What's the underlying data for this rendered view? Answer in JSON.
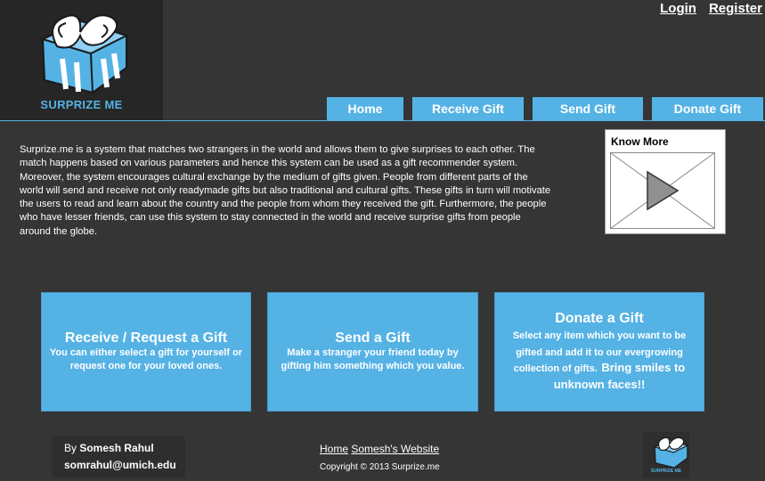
{
  "brand": {
    "name": "SURPRIZE ME",
    "logo_icon": "gift-box-icon"
  },
  "auth": {
    "login": "Login",
    "register": "Register"
  },
  "nav": {
    "home": "Home",
    "receive": "Receive Gift",
    "send": "Send Gift",
    "donate": "Donate Gift"
  },
  "intro": {
    "text": "Surprize.me is a system that matches two strangers in the world and allows them to give surprises to each other. The match happens based on various parameters and hence this system can be used as a gift recommender system. Moreover, the system encourages cultural exchange by the medium of gifts given. People from different parts of the world will send and receive not only readymade gifts but also traditional and cultural gifts. These gifts in turn will motivate the users to read and learn about the country and the people from whom they received the gift. Furthermore, the people who have lesser friends, can use this system to stay connected in the world and receive surprise gifts from people around the globe."
  },
  "know_more": {
    "title": "Know More",
    "icon": "play-video-icon"
  },
  "cards": {
    "receive": {
      "title": "Receive / Request a Gift",
      "desc": "You can either select a gift for yourself or request one for your loved ones."
    },
    "send": {
      "title": "Send a Gift",
      "desc": "Make a stranger your friend today by gifting him something which you value."
    },
    "donate": {
      "title": "Donate a Gift",
      "desc": "Select any item which you want to be gifted and add it to our evergrowing collection of gifts.",
      "desc_emphasis": "Bring smiles to unknown faces!!"
    }
  },
  "footer": {
    "author_prefix": "By ",
    "author_name": "Somesh Rahul",
    "email": "somrahul@umich.edu",
    "link_home": "Home",
    "link_website": "Somesh's Website",
    "copyright": "Copyright © 2013 Surprize.me",
    "logo_text": "SURPRIZE ME"
  },
  "colors": {
    "background": "#353535",
    "accent": "#55b2e4",
    "dark_panel": "#262626"
  }
}
